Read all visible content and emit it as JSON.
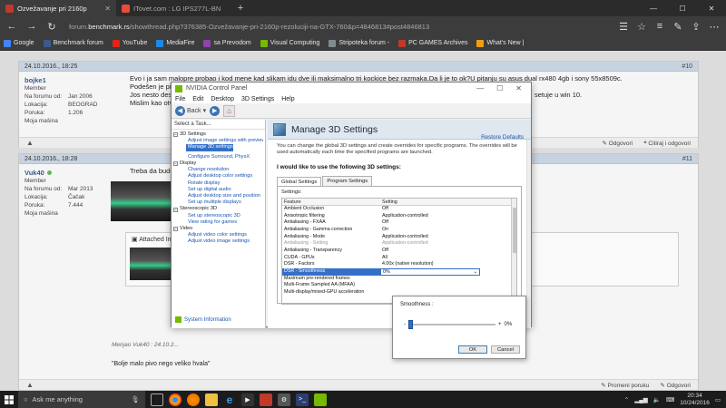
{
  "browser": {
    "tabs": [
      {
        "label": "Ozvežavanje pri 2160p",
        "active": true,
        "favicon_color": "#c0392b"
      },
      {
        "label": "ITovet.com : LG IPS277L-BN",
        "active": false,
        "favicon_color": "#e74c3c"
      }
    ],
    "address_prefix": "forum.",
    "address_domain": "benchmark.rs",
    "address_rest": "/showthread.php?376385-Ozvežavanje-pri-2160p-rezoluciji-na-GTX-760&p=4846813#post4846813",
    "favorites": [
      {
        "label": "Google",
        "color": "#4285f4"
      },
      {
        "label": "Benchmark forum",
        "color": "#3d5a8a"
      },
      {
        "label": "YouTube",
        "color": "#e62117"
      },
      {
        "label": "MediaFire",
        "color": "#1e88e5"
      },
      {
        "label": "sa Prevodom",
        "color": "#8e44ad"
      },
      {
        "label": "Visual Computing",
        "color": "#76b900"
      },
      {
        "label": "Stripoteka forum -",
        "color": "#7f8c8d"
      },
      {
        "label": "PC GAMES Archives",
        "color": "#c0392b"
      },
      {
        "label": "What's New |",
        "color": "#f39c12"
      }
    ]
  },
  "posts": [
    {
      "date": "24.10.2016., 18:25",
      "number": "#10",
      "username": "bojke1",
      "rank": "Member",
      "joined_label": "Na forumu od:",
      "joined": "Jan 2006",
      "location_label": "Lokacija:",
      "location": "BEOGRAD",
      "posts_label": "Poruka:",
      "posts_count": "1.206",
      "machine": "Moja mašina",
      "text_line1": "Evo i ja sam malopre probao i kod mene kad slikam idu dve ili maksimalno tri kockice bez razmaka.Da li je to ok?U pitanju su asus dual rx480 4gb i sony 55x8509c.",
      "text_line2": "Podešen je pixel format...",
      "text_line3": "Jos nesto desktop refresh...",
      "text_line3b": "setuje u win 10.",
      "text_line4": "Mislim kao otvorim...",
      "reply": "Odgovori",
      "quote_reply": "Citiraj i odgovori"
    },
    {
      "date": "24.10.2016., 18:28",
      "number": "#11",
      "username": "Vuk40",
      "rank": "Member",
      "joined_label": "Na forumu od:",
      "joined": "Mar 2013",
      "location_label": "Lokacija:",
      "location": "Čačak",
      "posts_label": "Poruka:",
      "posts_count": "7.444",
      "machine": "Moja mašina",
      "text_line1": "Treba da bude ovako",
      "attached": "Attached Im",
      "edited": "Menjao Vuk40 : 24.10.2...",
      "signature": "\"Bolje malo pivo nego veliko hvala\"",
      "edit": "Promeni poruku",
      "reply": "Odgovori"
    }
  ],
  "nvcp": {
    "title": "NVIDIA Control Panel",
    "menu": [
      "File",
      "Edit",
      "Desktop",
      "3D Settings",
      "Help"
    ],
    "back_label": "Back",
    "task_label": "Select a Task...",
    "tree": [
      {
        "category": "3D Settings",
        "items": [
          "Adjust image settings with preview",
          "Manage 3D settings",
          "Configure Surround, PhysX"
        ]
      },
      {
        "category": "Display",
        "items": [
          "Change resolution",
          "Adjust desktop color settings",
          "Rotate display",
          "Set up digital audio",
          "Adjust desktop size and position",
          "Set up multiple displays"
        ]
      },
      {
        "category": "Stereoscopic 3D",
        "items": [
          "Set up stereoscopic 3D",
          "View rating for games"
        ]
      },
      {
        "category": "Video",
        "items": [
          "Adjust video color settings",
          "Adjust video image settings"
        ]
      }
    ],
    "selected_item": "Manage 3D settings",
    "system_info": "System Information",
    "page_title": "Manage 3D Settings",
    "restore": "Restore Defaults",
    "description": "You can change the global 3D settings and create overrides for specific programs. The overrides will be used automatically each time the specified programs are launched.",
    "would_like": "I would like to use the following 3D settings:",
    "tabs": [
      "Global Settings",
      "Program Settings"
    ],
    "settings_label": "Settings:",
    "col_feature": "Feature",
    "col_setting": "Setting",
    "rows": [
      {
        "f": "Ambient Occlusion",
        "s": "Off",
        "dim": false
      },
      {
        "f": "Anisotropic filtering",
        "s": "Application-controlled",
        "dim": false
      },
      {
        "f": "Antialiasing - FXAA",
        "s": "Off",
        "dim": false
      },
      {
        "f": "Antialiasing - Gamma correction",
        "s": "On",
        "dim": false
      },
      {
        "f": "Antialiasing - Mode",
        "s": "Application-controlled",
        "dim": false
      },
      {
        "f": "Antialiasing - Setting",
        "s": "Application-controlled",
        "dim": true
      },
      {
        "f": "Antialiasing - Transparency",
        "s": "Off",
        "dim": false
      },
      {
        "f": "CUDA - GPUs",
        "s": "All",
        "dim": false
      },
      {
        "f": "DSR - Factors",
        "s": "4.00x (native resolution)",
        "dim": false
      },
      {
        "f": "DSR - Smoothness",
        "s": "0%",
        "dim": true,
        "sel": true
      },
      {
        "f": "Maximum pre-rendered frames",
        "s": "",
        "dim": false
      },
      {
        "f": "Multi-Frame Sampled AA (MFAA)",
        "s": "",
        "dim": false
      },
      {
        "f": "Multi-display/mixed-GPU acceleration",
        "s": "",
        "dim": false
      }
    ]
  },
  "smoothness_popup": {
    "title": "Smoothness :",
    "minus": "-",
    "plus": "+",
    "value": "0%",
    "value_fraction": 0.0,
    "ok": "OK",
    "cancel": "Cancel"
  },
  "taskbar": {
    "search_placeholder": "Ask me anything",
    "time": "20:34",
    "date": "10/24/2016"
  }
}
